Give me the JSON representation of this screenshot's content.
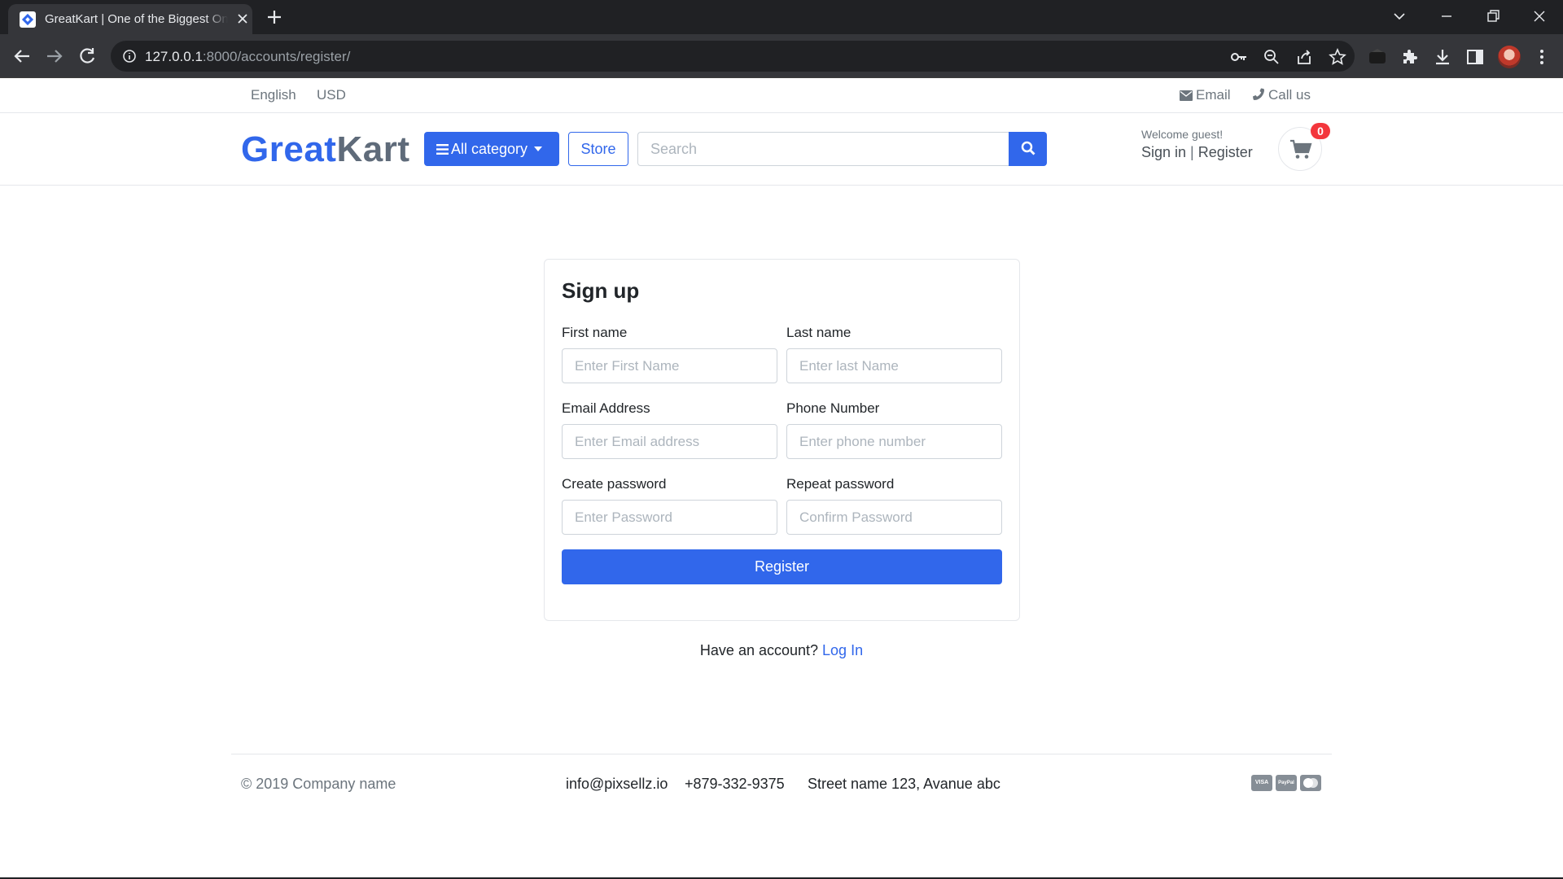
{
  "browser": {
    "tab_title": "GreatKart | One of the Biggest Online Shopping Platform",
    "url_host": "127.0.0.1",
    "url_rest": ":8000/accounts/register/"
  },
  "topbar": {
    "language": "English",
    "currency": "USD",
    "email_label": "Email",
    "call_label": "Call us"
  },
  "header": {
    "logo_part1": "Great",
    "logo_part2": "Kart",
    "category_button": "All category",
    "store_button": "Store",
    "search_placeholder": "Search",
    "welcome": "Welcome guest!",
    "sign_in": "Sign in",
    "separator": "|",
    "register": "Register",
    "cart_count": "0"
  },
  "form": {
    "title": "Sign up",
    "first_name_label": "First name",
    "first_name_placeholder": "Enter First Name",
    "last_name_label": "Last name",
    "last_name_placeholder": "Enter last Name",
    "email_label": "Email Address",
    "email_placeholder": "Enter Email address",
    "phone_label": "Phone Number",
    "phone_placeholder": "Enter phone number",
    "password_label": "Create password",
    "password_placeholder": "Enter Password",
    "repeat_label": "Repeat password",
    "repeat_placeholder": "Confirm Password",
    "submit": "Register"
  },
  "login_prompt": {
    "text": "Have an account?",
    "link": "Log In"
  },
  "footer": {
    "copyright": "© 2019 Company name",
    "email": "info@pixsellz.io",
    "phone": "+879-332-9375",
    "address": "Street name 123, Avanue abc",
    "payment_visa": "VISA",
    "payment_paypal": "PayPal"
  },
  "colors": {
    "primary": "#3167eb",
    "badge": "#f3363c",
    "chrome_dark": "#202124",
    "chrome_toolbar": "#35363a"
  },
  "icons": [
    "favicon-icon",
    "close-icon",
    "plus-icon",
    "chevron-down-icon",
    "minimize-icon",
    "restore-icon",
    "back-arrow-icon",
    "forward-arrow-icon",
    "reload-icon",
    "info-icon",
    "key-icon",
    "zoom-icon",
    "share-icon",
    "star-icon",
    "extension-icon",
    "puzzle-icon",
    "download-icon",
    "sidepanel-icon",
    "kebab-menu-icon",
    "envelope-icon",
    "phone-icon",
    "bars-icon",
    "search-icon",
    "cart-icon"
  ]
}
